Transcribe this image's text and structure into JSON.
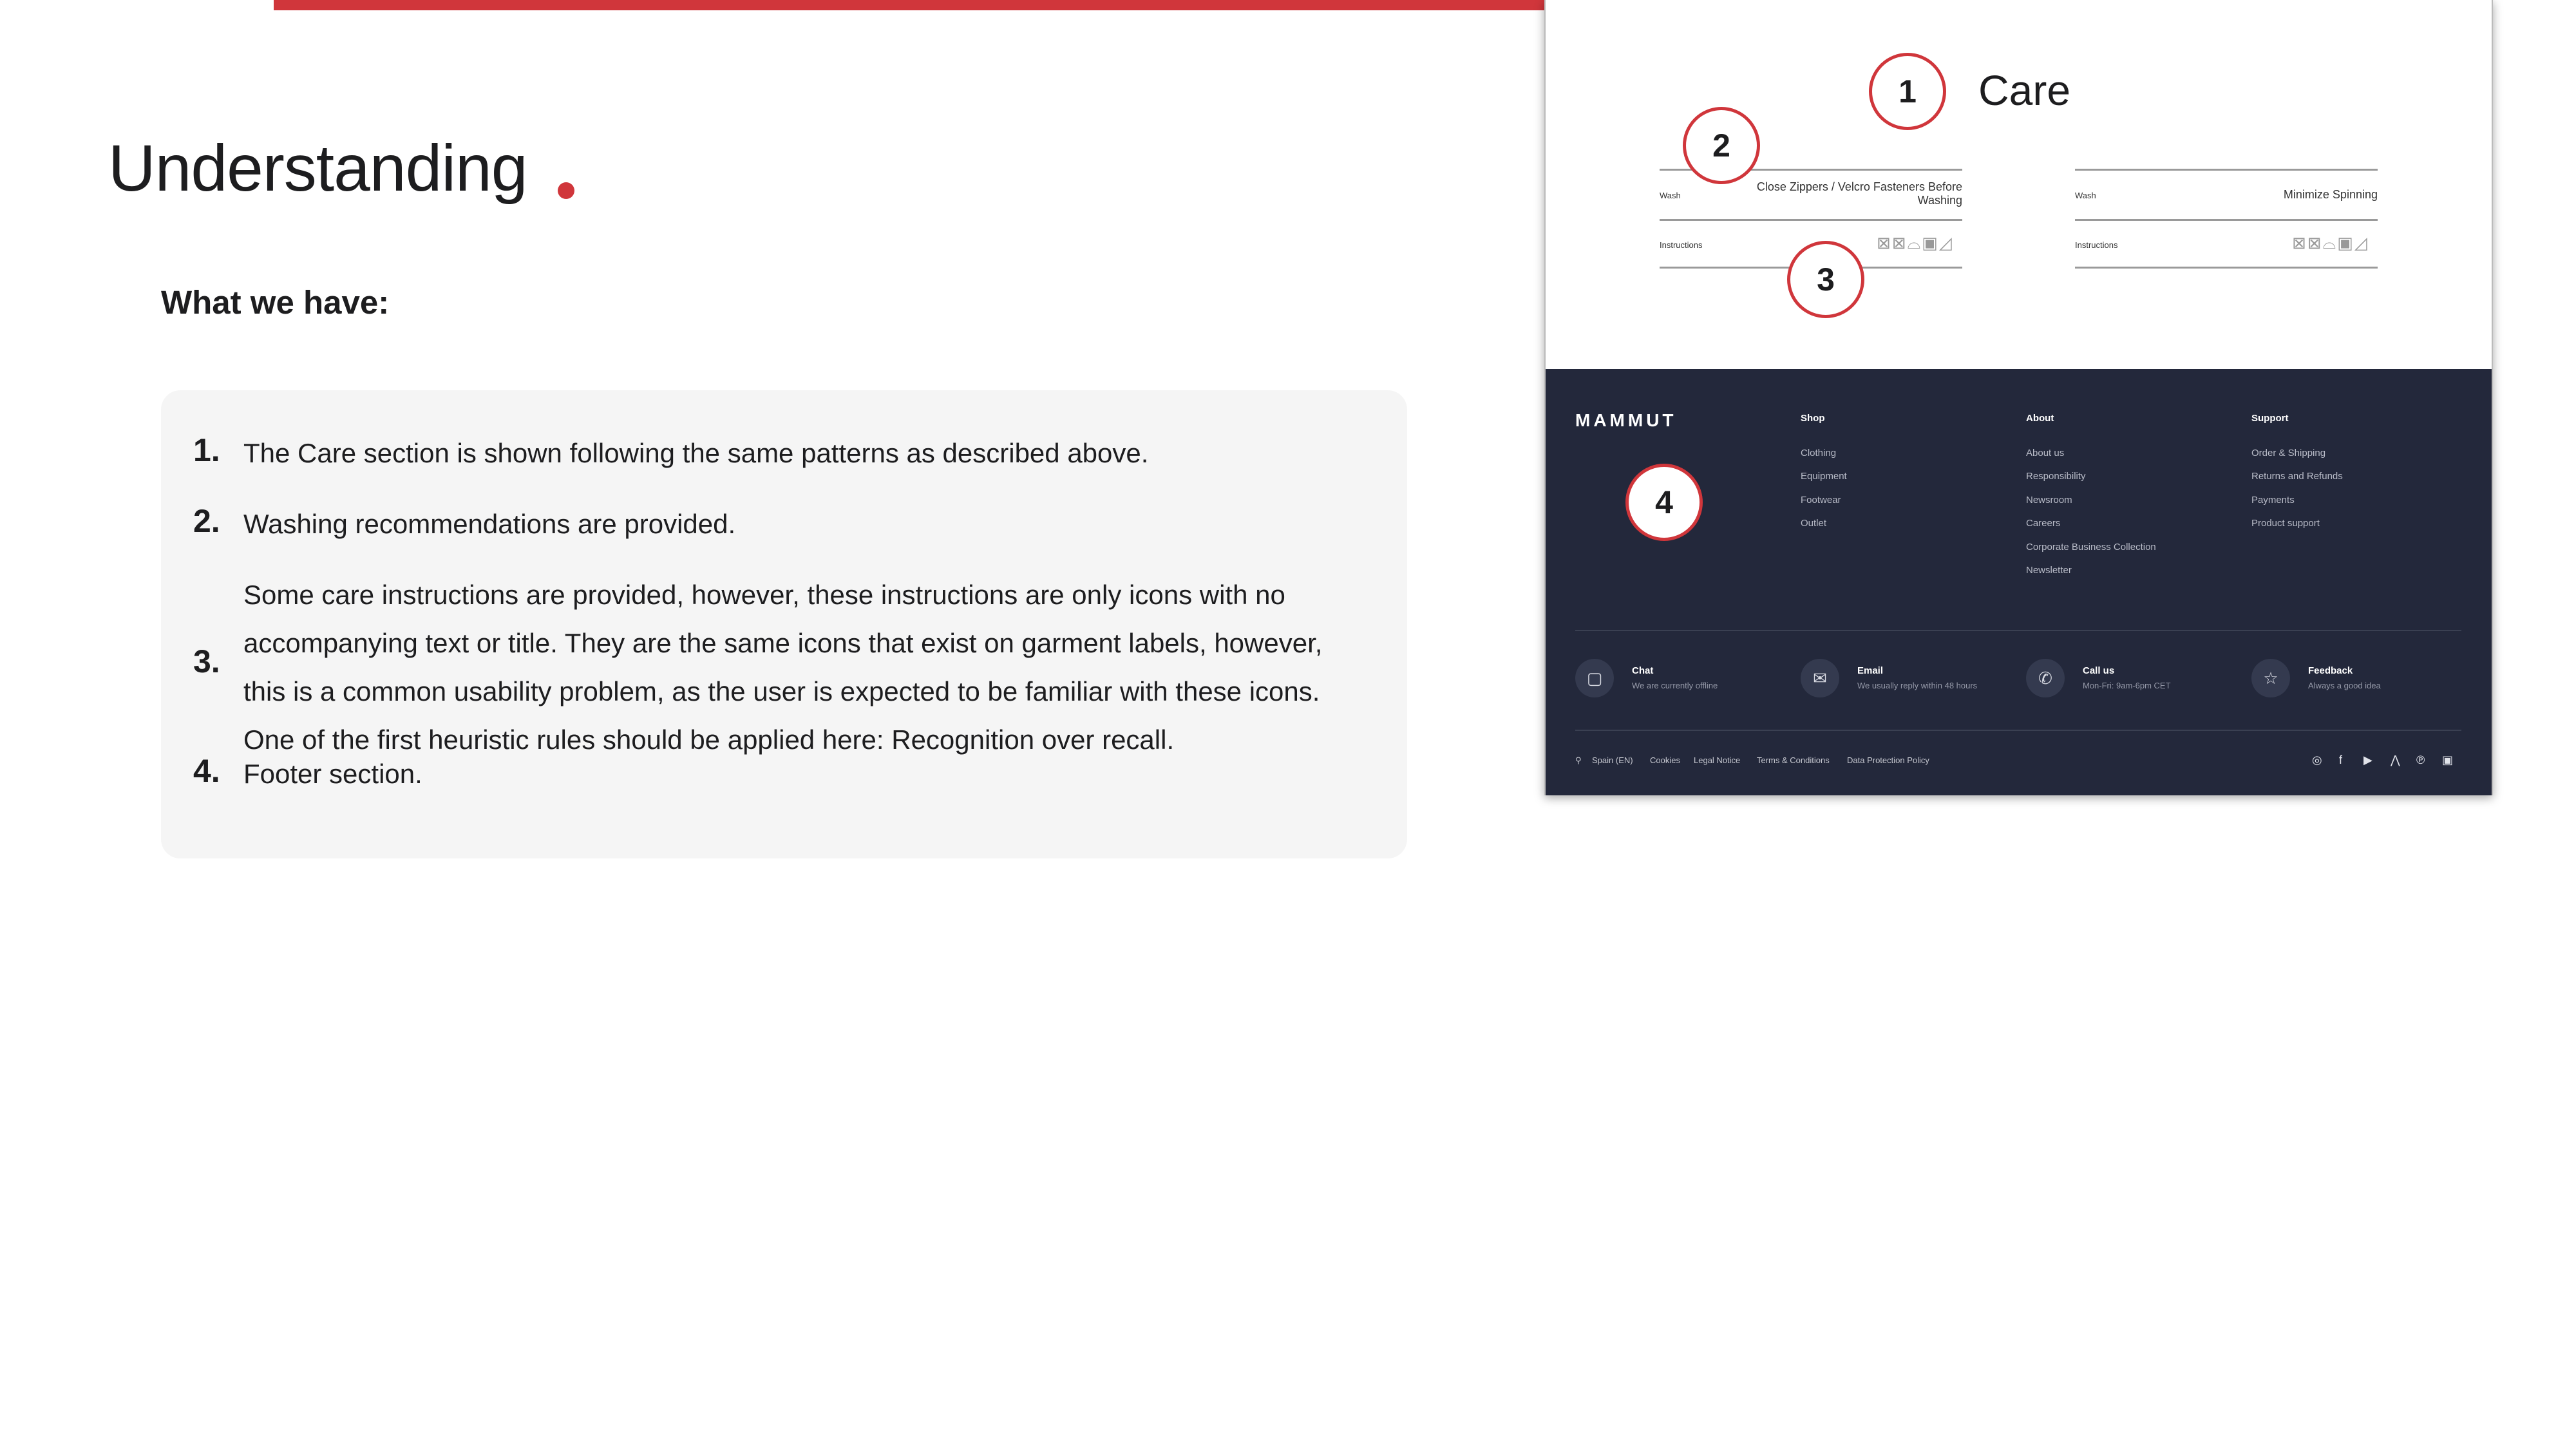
{
  "slide": {
    "title": "Understanding",
    "subtitle": "What we have:",
    "accent_color": "#d0363b",
    "items": [
      {
        "num": "1.",
        "text": "The Care section is shown following the same patterns as described above."
      },
      {
        "num": "2.",
        "text": "Washing recommendations are provided."
      },
      {
        "num": "3.",
        "text": "Some care instructions are provided, however, these instructions are only icons with no accompanying text or title. They are the same icons that exist on garment labels, however, this is a common usability problem, as the user is expected to be familiar with these icons. One of the first heuristic rules should be applied here: Recognition over recall."
      },
      {
        "num": "4.",
        "text": "Footer section."
      }
    ]
  },
  "screenshot": {
    "care_title": "Care",
    "markers": [
      "1",
      "2",
      "3",
      "4"
    ],
    "left_table": {
      "wash_label": "Wash",
      "wash_value": "Close Zippers / Velcro Fasteners Before Washing",
      "instructions_label": "Instructions",
      "icons": "⊠⊠⌓▣◿"
    },
    "right_table": {
      "wash_label": "Wash",
      "wash_value": "Minimize Spinning",
      "instructions_label": "Instructions",
      "icons": "⊠⊠⌓▣◿"
    },
    "footer": {
      "brand": "MAMMUT",
      "columns": [
        {
          "heading": "Shop",
          "links": [
            "Clothing",
            "Equipment",
            "Footwear",
            "Outlet"
          ]
        },
        {
          "heading": "About",
          "links": [
            "About us",
            "Responsibility",
            "Newsroom",
            "Careers",
            "Corporate Business Collection",
            "Newsletter"
          ]
        },
        {
          "heading": "Support",
          "links": [
            "Order & Shipping",
            "Returns and Refunds",
            "Payments",
            "Product support"
          ]
        }
      ],
      "contacts": [
        {
          "title": "Chat",
          "sub": "We are currently offline",
          "icon": "chat-icon"
        },
        {
          "title": "Email",
          "sub": "We usually reply within 48 hours",
          "icon": "mail-icon"
        },
        {
          "title": "Call us",
          "sub": "Mon-Fri: 9am-6pm CET",
          "icon": "phone-icon"
        },
        {
          "title": "Feedback",
          "sub": "Always a good idea",
          "icon": "star-icon"
        }
      ],
      "bottom": {
        "locale": "Spain (EN)",
        "links": [
          "Cookies",
          "Legal Notice",
          "Terms & Conditions",
          "Data Protection Policy"
        ]
      },
      "social": [
        "instagram-icon",
        "facebook-icon",
        "youtube-icon",
        "strava-icon",
        "pinterest-icon",
        "linkedin-icon"
      ]
    }
  }
}
